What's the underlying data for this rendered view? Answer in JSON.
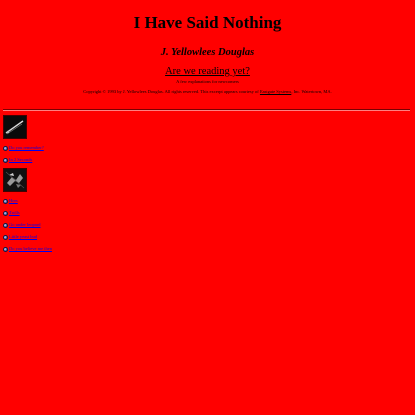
{
  "page": {
    "title": "I Have Said Nothing",
    "author": "J. Yellowlees Douglas",
    "reading_link": "Are we reading yet?",
    "reading_sub": "A few explanations for newcomers",
    "copyright": {
      "before": "Copyright © 1993 by J. Yellowlees Douglas. All rights reserved. This excerpt appears courtesy of",
      "link": "Eastgate Systems",
      "after": ", Inc. Watertown, MA."
    }
  },
  "sections": [
    {
      "thumb_icon": "needle-icon",
      "items": [
        {
          "label": "Do you remember?"
        },
        {
          "label": "In 2 Seconds"
        }
      ]
    },
    {
      "thumb_icon": "wreck-icon",
      "items": [
        {
          "label": "Hors"
        },
        {
          "label": "Trolls"
        },
        {
          "label": "Go under leopard"
        },
        {
          "label": "Little yeast bud"
        },
        {
          "label": "Do you believe me then"
        }
      ]
    }
  ],
  "colors": {
    "background": "#ff0000",
    "link": "#0000ee"
  }
}
